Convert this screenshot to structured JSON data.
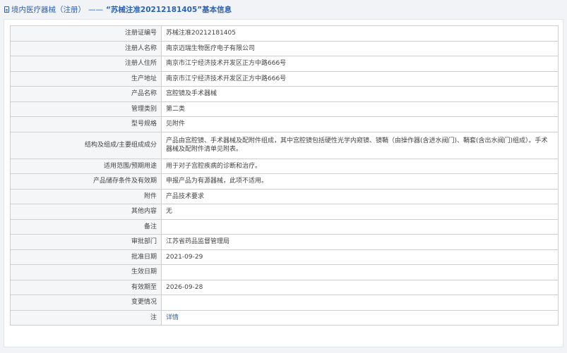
{
  "header": {
    "category": "境内医疗器械（注册）",
    "separator": "——",
    "title": "“苏械注准20212181405”基本信息"
  },
  "rows": [
    {
      "label": "注册证编号",
      "value": "苏械注准20212181405"
    },
    {
      "label": "注册人名称",
      "value": "南京迈瑞生物医疗电子有限公司"
    },
    {
      "label": "注册人住所",
      "value": "南京市江宁经济技术开发区正方中路666号"
    },
    {
      "label": "生产地址",
      "value": "南京市江宁经济技术开发区正方中路666号"
    },
    {
      "label": "产品名称",
      "value": "宫腔镜及手术器械"
    },
    {
      "label": "管理类别",
      "value": "第二类"
    },
    {
      "label": "型号规格",
      "value": "见附件"
    },
    {
      "label": "结构及组成/主要组成成分",
      "value": "产品由宫腔镜、手术器械及配附件组成，其中宫腔镜包括硬性光学内窥镜、镜鞘（由操作器(含进水阀门)、鞘套(含出水阀门)组成）。手术器械及配附件清单见附表。"
    },
    {
      "label": "适用范围/预期用途",
      "value": "用于对子宫腔疾病的诊断和治疗。"
    },
    {
      "label": "产品储存条件及有效期",
      "value": "申报产品为有源器械，此项不适用。"
    },
    {
      "label": "附件",
      "value": "产品技术要求"
    },
    {
      "label": "其他内容",
      "value": "无"
    },
    {
      "label": "备注",
      "value": ""
    },
    {
      "label": "审批部门",
      "value": "江苏省药品监督管理局"
    },
    {
      "label": "批准日期",
      "value": "2021-09-29"
    },
    {
      "label": "生效日期",
      "value": ""
    },
    {
      "label": "有效期至",
      "value": "2026-09-28"
    },
    {
      "label": "变更情况",
      "value": ""
    },
    {
      "label": "注",
      "value": "详情"
    }
  ],
  "colors": {
    "accent": "#2a62b8",
    "label_bg": "#f5f6f8",
    "border": "#cfcfcf"
  }
}
